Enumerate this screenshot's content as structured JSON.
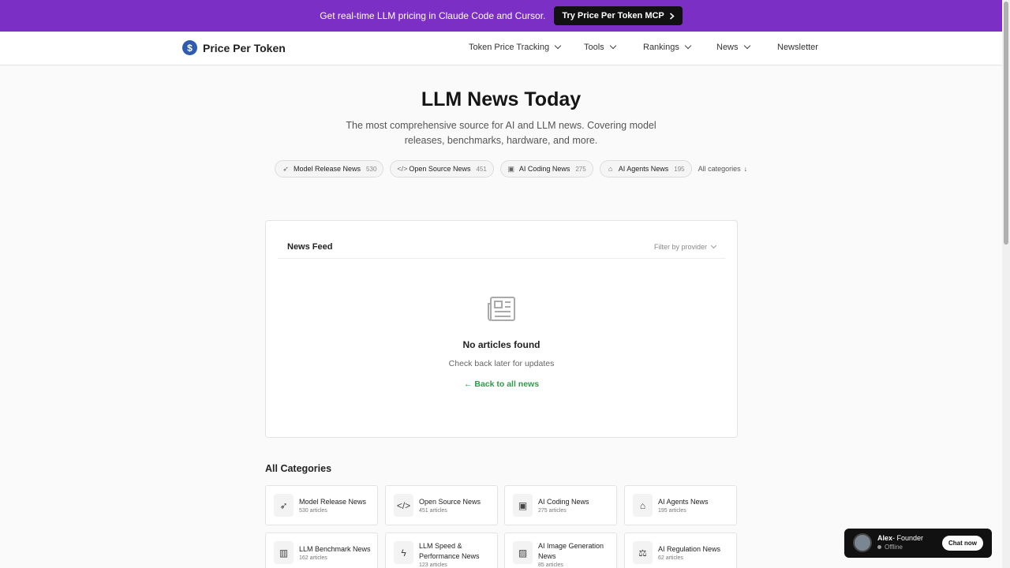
{
  "banner": {
    "text": "Get real-time LLM pricing in Claude Code and Cursor.",
    "button_label": "Try Price Per Token MCP"
  },
  "header": {
    "logo_text": "Price Per Token",
    "logo_mark": "$",
    "nav": [
      {
        "label": "Token Price Tracking",
        "has_dropdown": true
      },
      {
        "label": "Tools",
        "has_dropdown": true
      },
      {
        "label": "Rankings",
        "has_dropdown": true
      },
      {
        "label": "News",
        "has_dropdown": true
      },
      {
        "label": "Newsletter",
        "has_dropdown": false
      }
    ]
  },
  "hero": {
    "title": "LLM News Today",
    "subtitle": "The most comprehensive source for AI and LLM news. Covering model releases, benchmarks, hardware, and more."
  },
  "pills": [
    {
      "label": "Model Release News",
      "count": "530",
      "icon": "rocket-icon"
    },
    {
      "label": "Open Source News",
      "count": "451",
      "icon": "code-icon"
    },
    {
      "label": "AI Coding News",
      "count": "275",
      "icon": "terminal-icon"
    },
    {
      "label": "AI Agents News",
      "count": "195",
      "icon": "tag-icon"
    }
  ],
  "all_categories_link": "All categories",
  "feed": {
    "title": "News Feed",
    "filter_label": "Filter by provider",
    "empty_title": "No articles found",
    "empty_subtitle": "Check back later for updates",
    "back_link": "← Back to all news"
  },
  "categories": {
    "heading": "All Categories",
    "items": [
      {
        "name": "Model Release News",
        "count": "530 articles",
        "icon": "rocket-icon"
      },
      {
        "name": "Open Source News",
        "count": "451 articles",
        "icon": "code-icon"
      },
      {
        "name": "AI Coding News",
        "count": "275 articles",
        "icon": "terminal-icon"
      },
      {
        "name": "AI Agents News",
        "count": "195 articles",
        "icon": "tag-icon"
      },
      {
        "name": "LLM Benchmark News",
        "count": "162 articles",
        "icon": "bar-chart-icon"
      },
      {
        "name": "LLM Speed & Performance News",
        "count": "123 articles",
        "icon": "lightning-icon"
      },
      {
        "name": "AI Image Generation News",
        "count": "85 articles",
        "icon": "image-icon"
      },
      {
        "name": "AI Regulation News",
        "count": "62 articles",
        "icon": "scale-icon"
      }
    ]
  },
  "chat": {
    "name": "Alex",
    "role": "- Founder",
    "status": "Offline",
    "button_label": "Chat now"
  },
  "colors": {
    "banner_bg": "#7b2fc4",
    "link_green": "#2f9a4a",
    "logo_blue": "#2f5bb0"
  }
}
